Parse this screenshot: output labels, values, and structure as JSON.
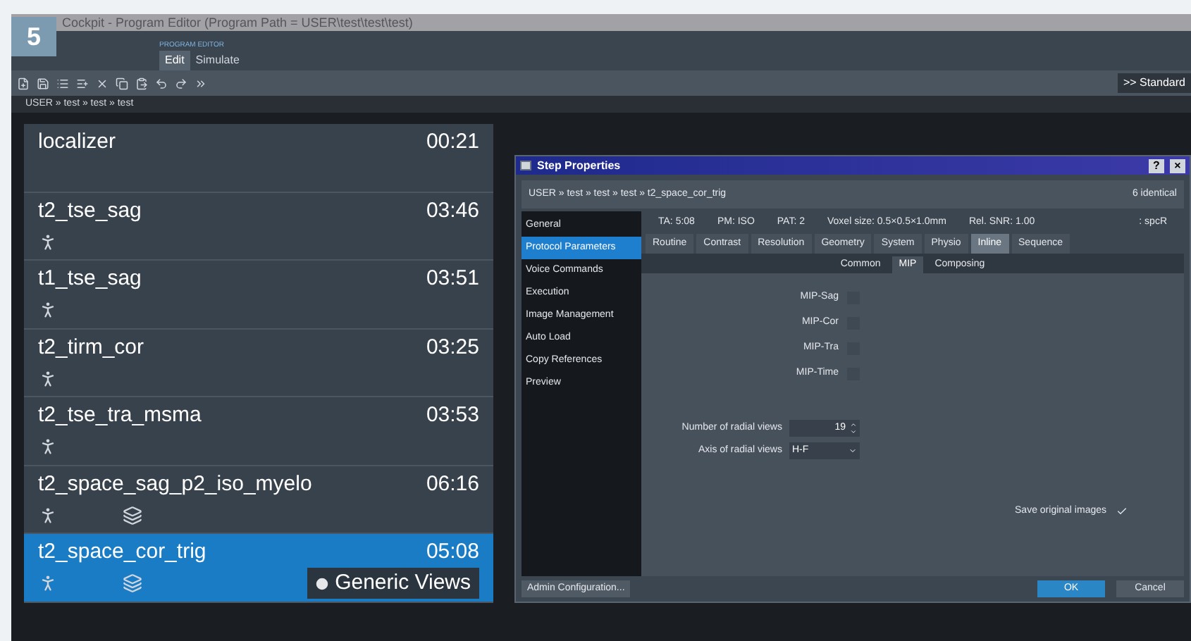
{
  "figure_number": "5",
  "window": {
    "title": "Cockpit - Program Editor (Program Path = USER\\test\\test\\test)"
  },
  "ribbon": {
    "group_label": "PROGRAM EDITOR",
    "tabs": [
      {
        "label": "Edit",
        "selected": true
      },
      {
        "label": "Simulate",
        "selected": false
      }
    ]
  },
  "toolbar": {
    "layout_button": ">> Standard"
  },
  "breadcrumb": "USER » test » test » test",
  "steps": [
    {
      "name": "localizer",
      "time": "00:21",
      "selected": false
    },
    {
      "name": "t2_tse_sag",
      "time": "03:46",
      "selected": false,
      "icons": [
        {
          "kind": "person"
        }
      ]
    },
    {
      "name": "t1_tse_sag",
      "time": "03:51",
      "selected": false,
      "icons": [
        {
          "kind": "person"
        }
      ]
    },
    {
      "name": "t2_tirm_cor",
      "time": "03:25",
      "selected": false,
      "icons": [
        {
          "kind": "person"
        }
      ]
    },
    {
      "name": "t2_tse_tra_msma",
      "time": "03:53",
      "selected": false,
      "icons": [
        {
          "kind": "person"
        }
      ]
    },
    {
      "name": "t2_space_sag_p2_iso_myelo",
      "time": "06:16",
      "selected": false,
      "icons": [
        {
          "kind": "person"
        },
        {
          "kind": "copy"
        }
      ]
    },
    {
      "name": "t2_space_cor_trig",
      "time": "05:08",
      "selected": true,
      "icons": [
        {
          "kind": "person"
        },
        {
          "kind": "copy"
        }
      ],
      "button": "Generic Views"
    }
  ],
  "dialog": {
    "title": "Step Properties",
    "help": "?",
    "close": "×",
    "breadcrumb": "USER » test » test » test » t2_space_cor_trig",
    "identical": "6 identical",
    "nav": [
      {
        "label": "General",
        "selected": false
      },
      {
        "label": "Protocol Parameters",
        "selected": true
      },
      {
        "label": "Voice Commands",
        "selected": false
      },
      {
        "label": "Execution",
        "selected": false
      },
      {
        "label": "Image Management",
        "selected": false
      },
      {
        "label": "Auto Load",
        "selected": false
      },
      {
        "label": "Copy References",
        "selected": false
      },
      {
        "label": "Preview",
        "selected": false
      }
    ],
    "info": [
      "TA: 5:08",
      "PM: ISO",
      "PAT: 2",
      "Voxel size: 0.5×0.5×1.0mm",
      "Rel. SNR: 1.00",
      ": spcR"
    ],
    "tabs": [
      {
        "label": "Routine",
        "selected": false
      },
      {
        "label": "Contrast",
        "selected": false
      },
      {
        "label": "Resolution",
        "selected": false
      },
      {
        "label": "Geometry",
        "selected": false
      },
      {
        "label": "System",
        "selected": false
      },
      {
        "label": "Physio",
        "selected": false
      },
      {
        "label": "Inline",
        "selected": true
      },
      {
        "label": "Sequence",
        "selected": false
      }
    ],
    "subtabs": [
      {
        "label": "Common",
        "selected": false
      },
      {
        "label": "MIP",
        "selected": true
      },
      {
        "label": "Composing",
        "selected": false
      }
    ],
    "checkboxes": [
      {
        "label": "MIP-Sag",
        "checked": false
      },
      {
        "label": "MIP-Cor",
        "checked": false
      },
      {
        "label": "MIP-Tra",
        "checked": false
      },
      {
        "label": "MIP-Time",
        "checked": false
      }
    ],
    "radial_views": {
      "label": "Number of radial views",
      "value": "19"
    },
    "axis": {
      "label": "Axis of radial views",
      "value": "H-F"
    },
    "save_original": {
      "label": "Save original images",
      "checked": true
    },
    "buttons": {
      "admin": "Admin Configuration...",
      "ok": "OK",
      "cancel": "Cancel"
    }
  }
}
